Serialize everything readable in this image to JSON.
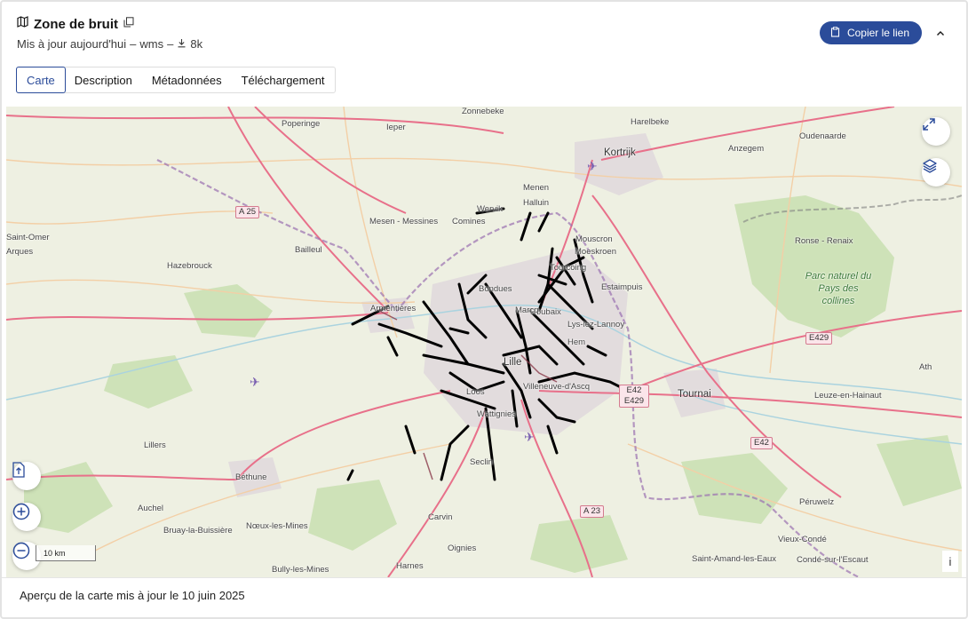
{
  "header": {
    "title": "Zone de bruit",
    "meta_updated": "Mis à jour aujourd'hui",
    "meta_sep1": "–",
    "meta_format": "wms",
    "meta_sep2": "–",
    "meta_downloads": "8k",
    "copy_link_label": "Copier le lien"
  },
  "tabs": [
    {
      "label": "Carte",
      "active": true
    },
    {
      "label": "Description",
      "active": false
    },
    {
      "label": "Métadonnées",
      "active": false
    },
    {
      "label": "Téléchargement",
      "active": false
    }
  ],
  "map": {
    "scale_label": "10 km",
    "info_label": "i",
    "places": [
      "Poperinge",
      "Ieper",
      "Harelbeke",
      "Kortrijk",
      "Oudenaarde",
      "Anzegem",
      "Menen",
      "Wervik",
      "Halluin",
      "Comines",
      "Mesen - Messines",
      "Bailleul",
      "Hazebrouck",
      "Saint-Omer",
      "Arques",
      "Mouscron",
      "Moeskroen",
      "Tourcoing",
      "Roubaix",
      "Bondues",
      "Marcq",
      "Estaimpuis",
      "Lys-lez-Lannoy",
      "Armentières",
      "Lille",
      "Villeneuve-d'Ascq",
      "Hem",
      "Loos",
      "Wattignies",
      "Seclin",
      "Tournai",
      "Ronse - Renaix",
      "Leuze-en-Hainaut",
      "Ath",
      "Lillers",
      "Béthune",
      "Auchel",
      "Bruay-la-Buissière",
      "Nœux-les-Mines",
      "Bully-les-Mines",
      "Carvin",
      "Harnes",
      "Oignies",
      "Péruwelz",
      "Vieux-Condé",
      "Condé-sur-l'Escaut",
      "Saint-Amand-les-Eaux",
      "Zonnebeke"
    ],
    "park_label": "Parc naturel du Pays des collines",
    "roads": [
      "A 25",
      "E429",
      "E42",
      "E42 E429",
      "A 23"
    ]
  },
  "footer": {
    "text": "Aperçu de la carte mis à jour le 10 juin 2025"
  },
  "colors": {
    "accent": "#2b4c9a",
    "road_major": "#e8708a",
    "road_minor": "#f5c8a0",
    "border": "#9a6fb0",
    "urban": "#e4dfe0",
    "water": "#aad3df",
    "noise_line": "#000000"
  }
}
